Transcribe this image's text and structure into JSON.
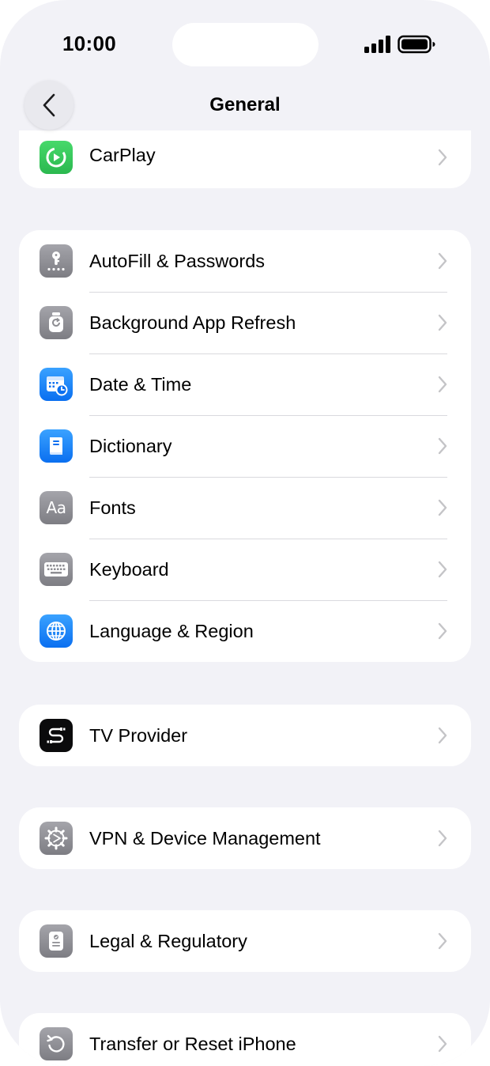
{
  "status_bar": {
    "time": "10:00"
  },
  "nav": {
    "title": "General"
  },
  "groups": [
    {
      "items": [
        {
          "label": "CarPlay",
          "icon": "carplay-icon",
          "color": "#34c759"
        }
      ]
    },
    {
      "items": [
        {
          "label": "AutoFill & Passwords",
          "icon": "key-icon",
          "color": "#8e8e93"
        },
        {
          "label": "Background App Refresh",
          "icon": "refresh-icon",
          "color": "#8e8e93"
        },
        {
          "label": "Date & Time",
          "icon": "calendar-clock-icon",
          "color": "#0a84ff"
        },
        {
          "label": "Dictionary",
          "icon": "book-icon",
          "color": "#0a84ff"
        },
        {
          "label": "Fonts",
          "icon": "fonts-icon",
          "color": "#8e8e93",
          "glyph": "Aa"
        },
        {
          "label": "Keyboard",
          "icon": "keyboard-icon",
          "color": "#8e8e93"
        },
        {
          "label": "Language & Region",
          "icon": "globe-icon",
          "color": "#0a84ff"
        }
      ]
    },
    {
      "items": [
        {
          "label": "TV Provider",
          "icon": "tv-provider-icon",
          "color": "#000000"
        }
      ]
    },
    {
      "items": [
        {
          "label": "VPN & Device Management",
          "icon": "gear-icon",
          "color": "#8e8e93"
        }
      ]
    },
    {
      "items": [
        {
          "label": "Legal & Regulatory",
          "icon": "document-icon",
          "color": "#8e8e93"
        }
      ]
    },
    {
      "items": [
        {
          "label": "Transfer or Reset iPhone",
          "icon": "reset-icon",
          "color": "#8e8e93"
        }
      ]
    }
  ]
}
